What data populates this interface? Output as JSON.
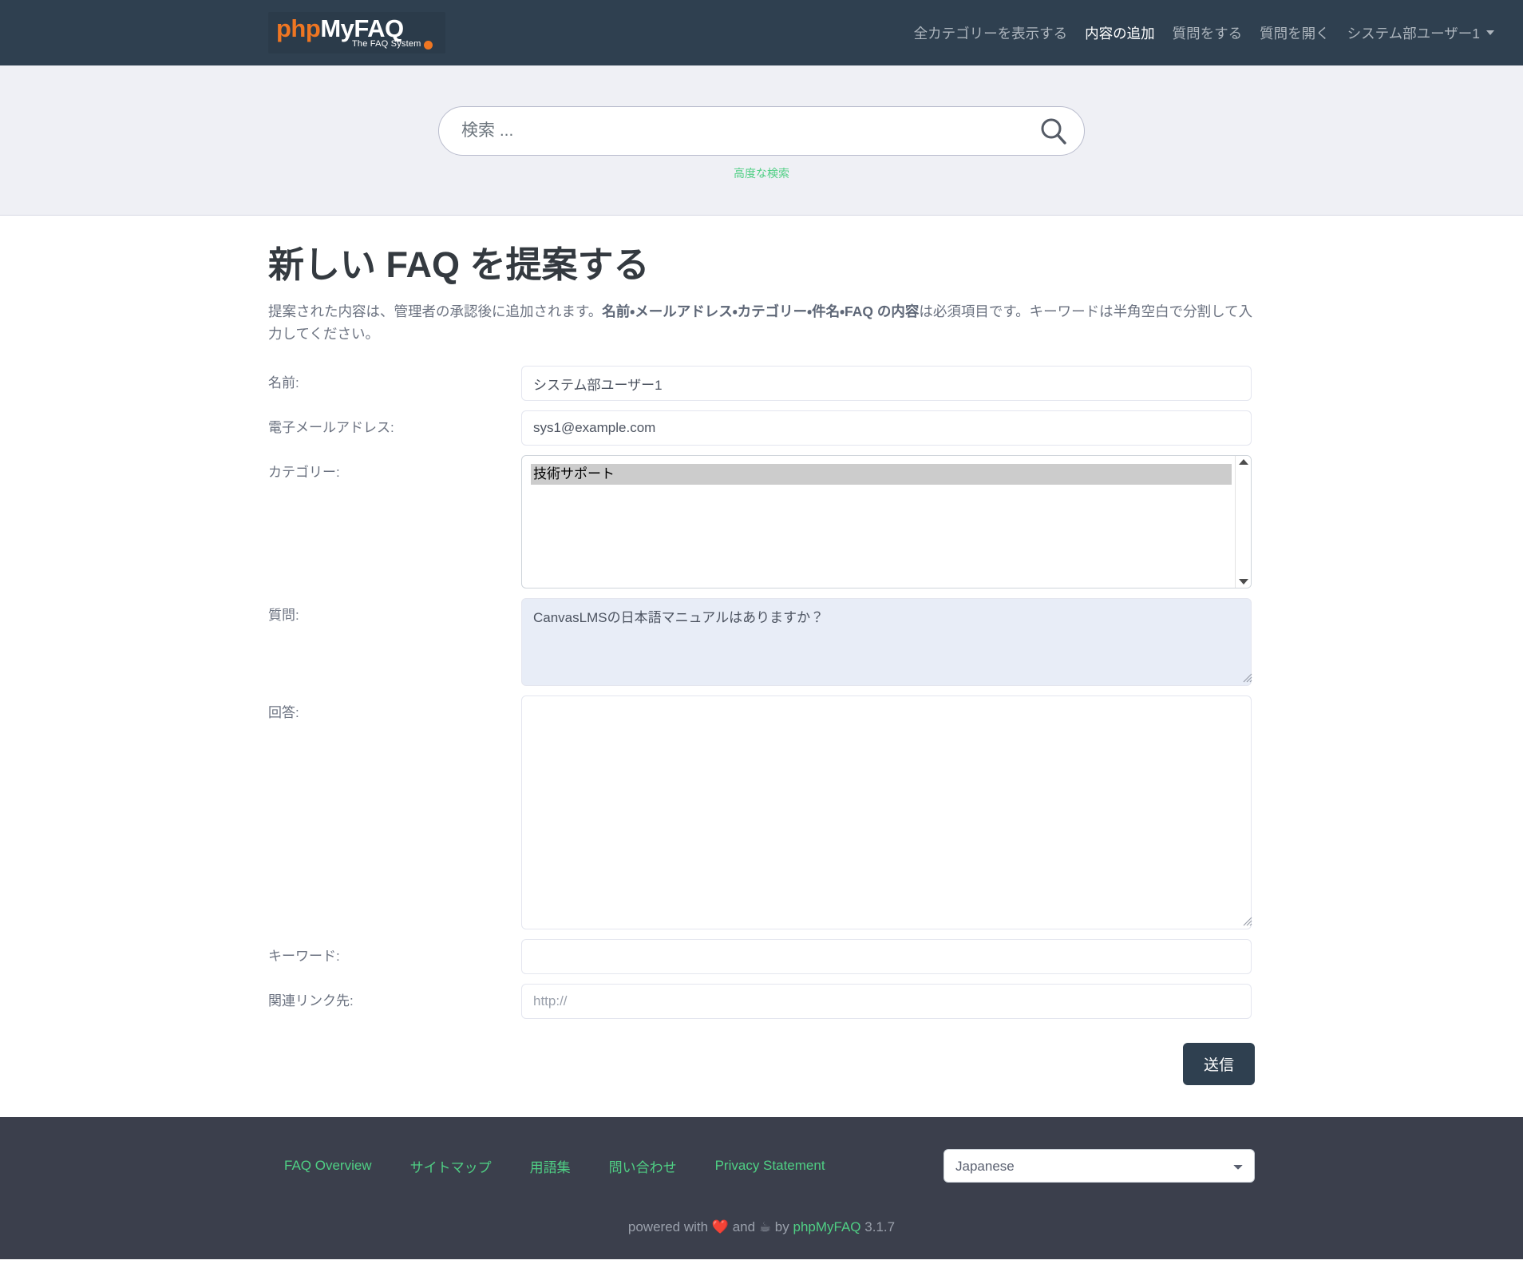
{
  "brand": {
    "php": "php",
    "myfaq": "MyFAQ",
    "tagline": "The FAQ System"
  },
  "nav": {
    "links": [
      {
        "label": "全カテゴリーを表示する",
        "active": false
      },
      {
        "label": "内容の追加",
        "active": true
      },
      {
        "label": "質問をする",
        "active": false
      },
      {
        "label": "質問を開く",
        "active": false
      }
    ],
    "user": "システム部ユーザー1"
  },
  "search": {
    "placeholder": "検索 ...",
    "icon": "search-icon",
    "advanced_label": "高度な検索"
  },
  "page": {
    "title": "新しい FAQ を提案する",
    "desc_part1": "提案された内容は、管理者の承認後に追加されます。",
    "desc_bold": "名前・メールアドレス・カテゴリー・件名・FAQ の内容",
    "desc_part2": "は必須項目です。キーワードは半角空白で分割して入力してください。"
  },
  "form": {
    "name": {
      "label": "名前:",
      "value": "システム部ユーザー1"
    },
    "email": {
      "label": "電子メールアドレス:",
      "value": "sys1@example.com"
    },
    "category": {
      "label": "カテゴリー:",
      "options": [
        "技術サポート"
      ],
      "selected": "技術サポート"
    },
    "question": {
      "label": "質問:",
      "value": "CanvasLMSの日本語マニュアルはありますか？"
    },
    "answer": {
      "label": "回答:",
      "value": ""
    },
    "keywords": {
      "label": "キーワード:",
      "value": ""
    },
    "link": {
      "label": "関連リンク先:",
      "value": "",
      "placeholder": "http://"
    },
    "submit_label": "送信"
  },
  "footer": {
    "links": [
      "FAQ Overview",
      "サイトマップ",
      "用語集",
      "問い合わせ",
      "Privacy Statement"
    ],
    "language": "Japanese",
    "language_options": [
      "Japanese"
    ],
    "credit_prefix": "powered with",
    "credit_heart": "❤️",
    "credit_and": "and",
    "credit_coffee": "☕",
    "credit_by": "by",
    "credit_brand": "phpMyFAQ",
    "credit_version": "3.1.7"
  },
  "colors": {
    "navbar": "#2f4050",
    "search_band": "#eff0f5",
    "accent_green": "#4fcf84",
    "brand_orange": "#ef7622",
    "footer": "#3b3f4c",
    "autofill": "#e8edf7"
  }
}
